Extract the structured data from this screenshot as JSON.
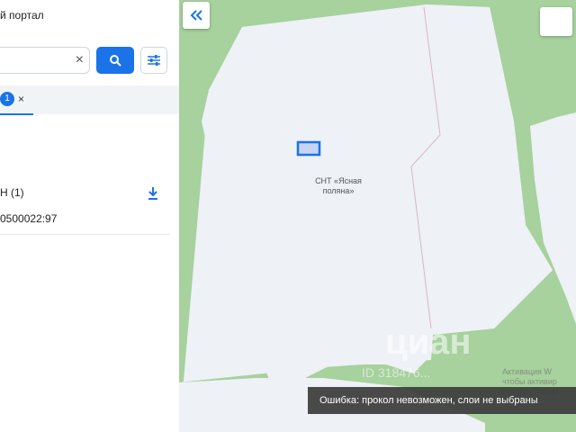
{
  "sidebar": {
    "title": "й портал",
    "search": {
      "value": "",
      "placeholder": ""
    },
    "tabs": [
      {
        "badge": "1",
        "close": "×"
      }
    ],
    "group": {
      "label": "Н (1)"
    },
    "results": [
      {
        "number": "0500022:97"
      }
    ]
  },
  "map": {
    "label": "СНТ «Ясная поляна»",
    "toast": "Ошибка: прокол невозможен, слои не выбраны",
    "watermark": {
      "brand": "циан",
      "id": "ID 318476...",
      "note": "Активация W\nчтобы активир\nраздел \"Парам"
    }
  },
  "colors": {
    "accent": "#1a73e8",
    "forest": "#a7d19d",
    "land": "#eef1f6",
    "parcel_outline": "#1a73e8",
    "parcel_fill": "#c7d4f2"
  },
  "icons": {
    "search": "search-icon",
    "clear": "close-icon",
    "filter": "filter-icon",
    "download": "download-icon",
    "collapse": "double-chevron-left-icon"
  }
}
